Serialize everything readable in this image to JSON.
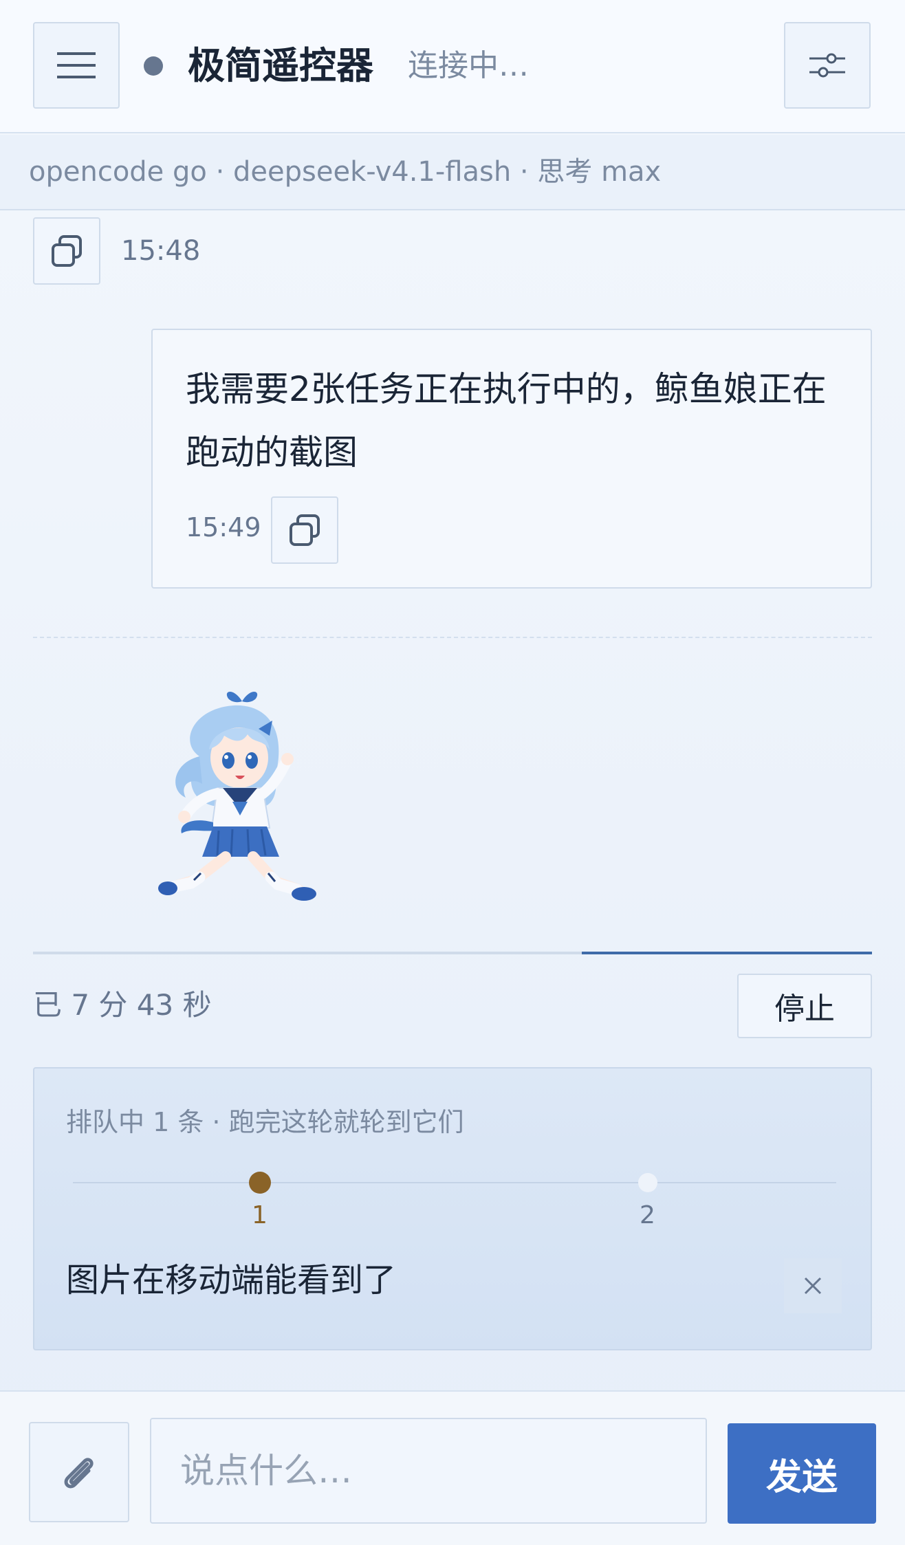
{
  "header": {
    "title": "极简遥控器",
    "status": "连接中…",
    "menu_icon": "hamburger-menu-icon",
    "settings_icon": "sliders-icon"
  },
  "model_bar": {
    "text": "opencode go · deepseek-v4.1-flash · 思考 max"
  },
  "messages": [
    {
      "time": "15:48",
      "copy_icon": "copy-icon"
    },
    {
      "text": "我需要2张任务正在执行中的，鲸鱼娘正在跑动的截图",
      "time": "15:49",
      "copy_icon": "copy-icon"
    }
  ],
  "run": {
    "progress": 0.35,
    "elapsed": "已 7 分 43 秒",
    "stop_label": "停止"
  },
  "queue": {
    "header": "排队中 1 条 · 跑完这轮就轮到它们",
    "steps": [
      "1",
      "2"
    ],
    "active_step": 1,
    "item_text": "图片在移动端能看到了",
    "remove_icon": "close-icon"
  },
  "composer": {
    "attach_icon": "paperclip-icon",
    "placeholder": "说点什么…",
    "send_label": "发送"
  },
  "colors": {
    "accent": "#3d6fc4",
    "active_step": "#8a6328",
    "progress": "#3e6ba8"
  }
}
